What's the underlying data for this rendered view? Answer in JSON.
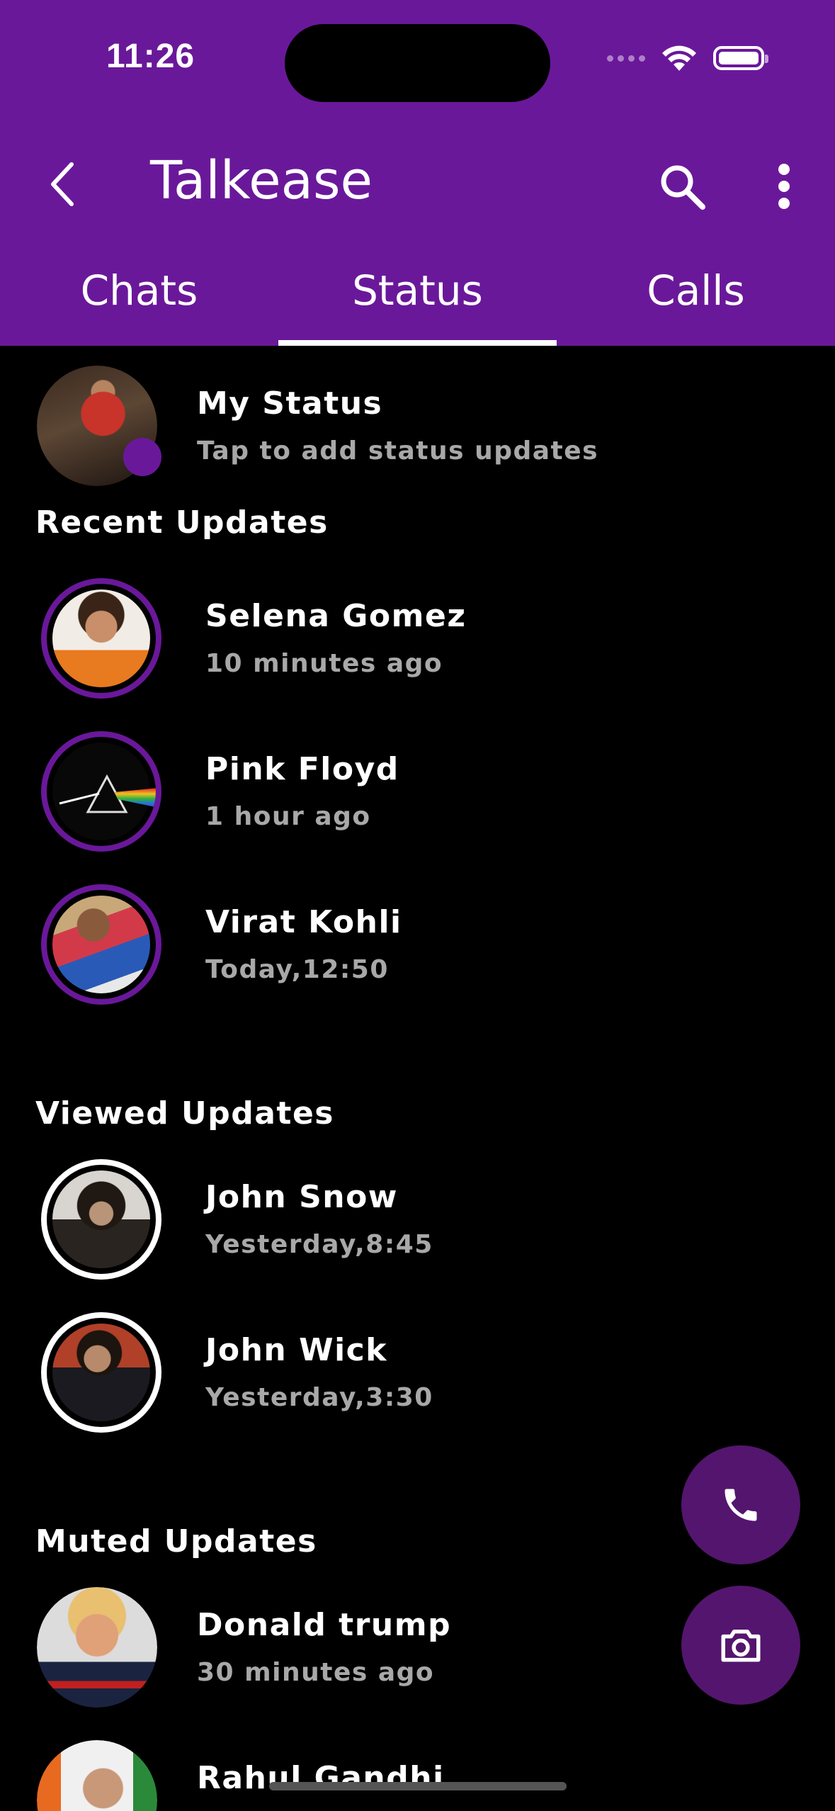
{
  "status_bar": {
    "time": "11:26"
  },
  "header": {
    "title": "Talkease"
  },
  "tabs": [
    {
      "label": "Chats"
    },
    {
      "label": "Status"
    },
    {
      "label": "Calls"
    }
  ],
  "my_status": {
    "name": "My Status",
    "subtitle": "Tap to add status updates"
  },
  "recent": {
    "heading": "Recent Updates",
    "items": [
      {
        "name": "Selena Gomez",
        "time": "10 minutes ago"
      },
      {
        "name": "Pink Floyd",
        "time": "1 hour ago"
      },
      {
        "name": "Virat Kohli",
        "time": "Today,12:50"
      }
    ]
  },
  "viewed": {
    "heading": "Viewed Updates",
    "items": [
      {
        "name": "John Snow",
        "time": "Yesterday,8:45"
      },
      {
        "name": "John Wick",
        "time": "Yesterday,3:30"
      }
    ]
  },
  "muted": {
    "heading": "Muted Updates",
    "items": [
      {
        "name": "Donald trump",
        "time": "30 minutes ago"
      },
      {
        "name": "Rahul Gandhi",
        "time": ""
      }
    ]
  },
  "colors": {
    "appbar": "#6a189a",
    "fab": "#54156e",
    "ring": "#6a189a"
  },
  "icons": {
    "back": "back-arrow-icon",
    "search": "search-icon",
    "more": "more-vert-icon",
    "call": "phone-icon",
    "camera": "camera-icon"
  }
}
